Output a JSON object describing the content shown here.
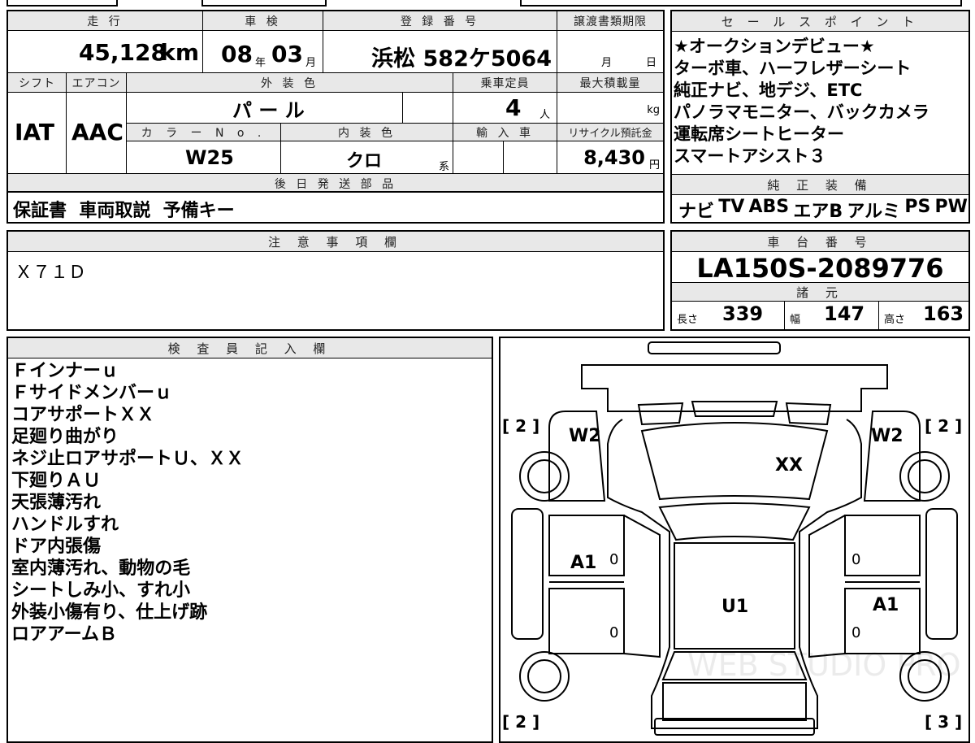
{
  "vehicle": {
    "headers": {
      "mileage": "走 行",
      "inspection": "車 検",
      "registration": "登 録 番 号",
      "transfer_deadline": "譲渡書類期限",
      "shift": "シフト",
      "aircon": "エアコン",
      "exterior_color": "外 装 色",
      "capacity": "乗車定員",
      "max_load": "最大積載量",
      "color_no": "カ ラ ー N o .",
      "interior_color": "内 装 色",
      "import": "輸 入 車",
      "recycle_fee": "リサイクル預託金"
    },
    "mileage_value": "45,128",
    "mileage_unit": "km",
    "inspection_year": "08",
    "inspection_year_unit": "年",
    "inspection_month": "03",
    "inspection_month_unit": "月",
    "registration_number": "浜松 582ケ5064",
    "deadline_month_unit": "月",
    "deadline_day_unit": "日",
    "shift_value": "IAT",
    "aircon_value": "AAC",
    "exterior_color_value": "パ ー ル",
    "capacity_value": "4",
    "capacity_unit": "人",
    "max_load_unit": "kg",
    "color_no_value": "W25",
    "interior_color_value": "クロ",
    "interior_color_suffix": "系",
    "recycle_fee_value": "8,430",
    "recycle_fee_unit": "円"
  },
  "later_parts": {
    "header": "後 日 発 送 部 品",
    "value": "保証書  車両取説  予備キー"
  },
  "sales_points": {
    "header": "セ ー ル ス ポ イ ン ト",
    "lines": [
      "★オークションデビュー★",
      "ターボ車、ハーフレザーシート",
      "純正ナビ、地デジ、ETC",
      "パノラマモニター、バックカメラ",
      "運転席シートヒーター",
      "スマートアシスト３"
    ]
  },
  "factory_equipment": {
    "header": "純 正 装 備",
    "items": [
      "ナビ",
      "TV",
      "ABS",
      "エアB",
      "アルミ",
      "PS",
      "PW"
    ]
  },
  "notes": {
    "header": "注 意 事 項 欄",
    "value": "Ｘ７１Ｄ"
  },
  "chassis": {
    "header": "車 台 番 号",
    "value": "LA150S-2089776",
    "dims_header": "諸 元",
    "length_label": "長さ",
    "length_value": "339",
    "width_label": "幅",
    "width_value": "147",
    "height_label": "高さ",
    "height_value": "163"
  },
  "inspector": {
    "header": "検 査 員 記 入 欄",
    "lines": [
      "Ｆインナーｕ",
      "Ｆサイドメンバーｕ",
      "コアサポートＸＸ",
      "足廻り曲がり",
      "ネジ止ロアサポートＵ、ＸＸ",
      "下廻りＡＵ",
      "天張薄汚れ",
      "ハンドルすれ",
      "ドア内張傷",
      "室内薄汚れ、動物の毛",
      "シートしみ小、すれ小",
      "外装小傷有り、仕上げ跡",
      "ロアアームＢ"
    ]
  },
  "diagram": {
    "marks": {
      "front_left_tire": "W2",
      "front_right_tire": "W2",
      "hood": "XX",
      "left_front_door": "A1",
      "right_rear_door": "A1",
      "roof": "U1",
      "lf_door_small": "0",
      "lr_door_small": "0",
      "rf_door_small": "0",
      "rr_door_small": "0"
    },
    "tread_front_left": "[ 2 ]",
    "tread_front_right": "[ 2 ]",
    "tread_rear_left": "[ 2 ]",
    "tread_rear_right": "[ 3 ]",
    "watermark": "WEB STUDIO PRO"
  }
}
